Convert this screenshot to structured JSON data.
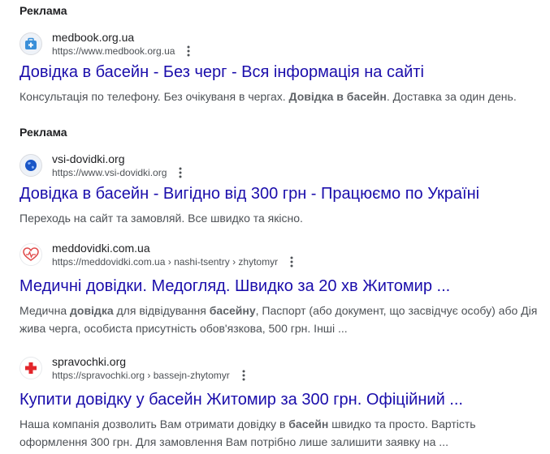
{
  "results": [
    {
      "ad_label": "Реклама",
      "site_name": "medbook.org.ua",
      "site_url": "https://www.medbook.org.ua",
      "title": "Довідка в басейн - Без черг - Вся інформація на сайті",
      "snippet_parts": [
        {
          "text": "Консультація по телефону. Без очікуваня в чергах. ",
          "bold": false
        },
        {
          "text": "Довідка в басейн",
          "bold": true
        },
        {
          "text": ". Доставка за один день.",
          "bold": false
        }
      ],
      "icon": "medical-bag-icon"
    },
    {
      "ad_label": "Реклама",
      "site_name": "vsi-dovidki.org",
      "site_url": "https://www.vsi-dovidki.org",
      "title": "Довідка в басейн - Вигідно від 300 грн - Працюємо по Україні",
      "snippet_parts": [
        {
          "text": "Переходь на сайт та замовляй. Все швидко та якісно.",
          "bold": false
        }
      ],
      "icon": "globe-icon"
    },
    {
      "site_name": "meddovidki.com.ua",
      "site_url": "https://meddovidki.com.ua › nashi-tsentry › zhytomyr",
      "title": "Медичні довідки. Медогляд. Швидко за 20 хв Житомир ...",
      "snippet_parts": [
        {
          "text": "Медична ",
          "bold": false
        },
        {
          "text": "довідка",
          "bold": true
        },
        {
          "text": " для відвідування ",
          "bold": false
        },
        {
          "text": "басейну",
          "bold": true
        },
        {
          "text": ", Паспорт (або документ, що засвідчує особу) або Дія жива черга, особиста присутність обов'язкова, 500 грн. Інші ...",
          "bold": false
        }
      ],
      "icon": "heart-pulse-icon"
    },
    {
      "site_name": "spravochki.org",
      "site_url": "https://spravochki.org › bassejn-zhytomyr",
      "title": "Купити довідку у басейн Житомир за 300 грн. Офіційний ...",
      "snippet_parts": [
        {
          "text": "Наша компанія дозволить Вам отримати довідку в ",
          "bold": false
        },
        {
          "text": "басейн",
          "bold": true
        },
        {
          "text": " швидко та просто. Вартість оформлення 300 грн. Для замовлення Вам потрібно лише залишити заявку на ...",
          "bold": false
        }
      ],
      "icon": "red-cross-icon"
    }
  ],
  "colors": {
    "title_link": "#1a0dab",
    "text": "#202124",
    "secondary_text": "#4d5156"
  }
}
